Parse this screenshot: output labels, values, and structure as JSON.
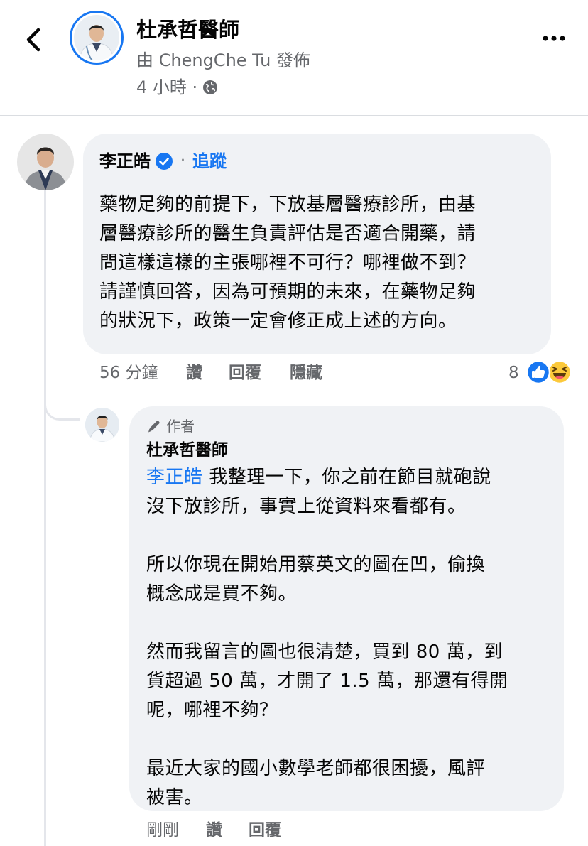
{
  "header": {
    "page_name": "杜承哲醫師",
    "posted_by": "由 ChengChe Tu 發佈",
    "time": "4 小時 ·",
    "back_icon": "chevron-left-icon",
    "more_icon": "more-horizontal-icon",
    "privacy_icon": "globe-icon"
  },
  "comment1": {
    "author": "李正皓",
    "separator": "·",
    "follow_label": "追蹤",
    "lines": [
      "藥物足夠的前提下，下放基層醫療診所，由基",
      "層醫療診所的醫生負責評估是否適合開藥，請",
      "問這樣這樣的主張哪裡不可行？哪裡做不到？",
      "請謹慎回答，因為可預期的未來，在藥物足夠",
      "的狀況下，政策一定會修正成上述的方向。"
    ],
    "time": "56 分鐘",
    "like_label": "讚",
    "reply_label": "回覆",
    "hide_label": "隱藏",
    "reaction_count": "8",
    "reactions": [
      "like-icon",
      "haha-icon"
    ]
  },
  "reply1": {
    "badge": "作者",
    "author": "杜承哲醫師",
    "mention": "李正皓",
    "line1_rest": " 我整理一下，你之前在節目就砲說",
    "lines": [
      "沒下放診所，事實上從資料來看都有。",
      "",
      "所以你現在開始用蔡英文的圖在凹，偷換",
      "概念成是買不夠。",
      "",
      "然而我留言的圖也很清楚，買到 80 萬，到",
      "貨超過 50 萬，才開了 1.5 萬，那還有得開",
      "呢，哪裡不夠？",
      "",
      "最近大家的國小數學老師都很困擾，風評",
      "被害。"
    ],
    "time": "剛剛",
    "like_label": "讚",
    "reply_label": "回覆"
  },
  "colors": {
    "accent": "#1877f2",
    "secondary_text": "#65676b",
    "bubble": "#f0f2f5",
    "verified": "#1877f2"
  }
}
